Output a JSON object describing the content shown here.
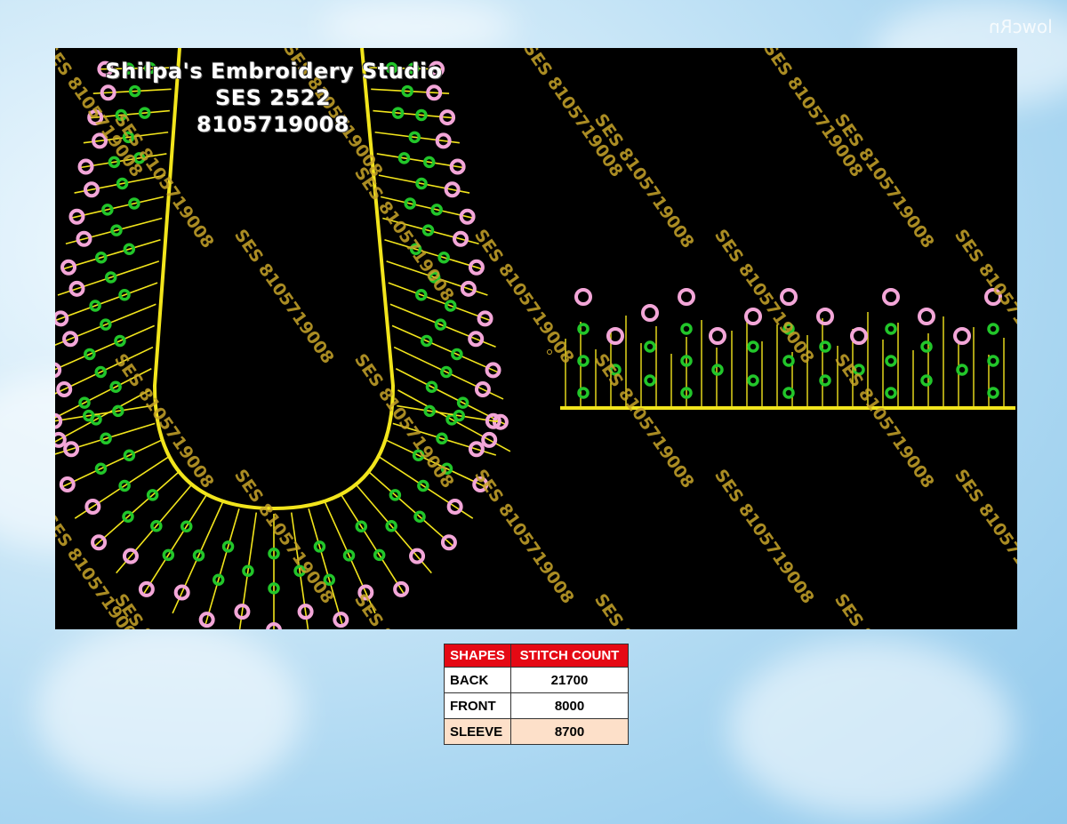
{
  "logo": "lowcRn",
  "studio": {
    "name": "Shilpa's Embroidery Studio",
    "code": "SES 2522",
    "phone": "8105719008"
  },
  "watermark": "SES 8105719008",
  "colors": {
    "canvas": "#000000",
    "outline": "#f2e51c",
    "ring": "#f3a6d8",
    "dot": "#22c62a",
    "table_header": "#e50914",
    "row_highlight": "#fde0c9"
  },
  "table": {
    "headers": [
      "SHAPES",
      "STITCH COUNT"
    ],
    "rows": [
      {
        "shape": "BACK",
        "count": "21700"
      },
      {
        "shape": "FRONT",
        "count": "8000"
      },
      {
        "shape": "SLEEVE",
        "count": "8700"
      }
    ]
  }
}
